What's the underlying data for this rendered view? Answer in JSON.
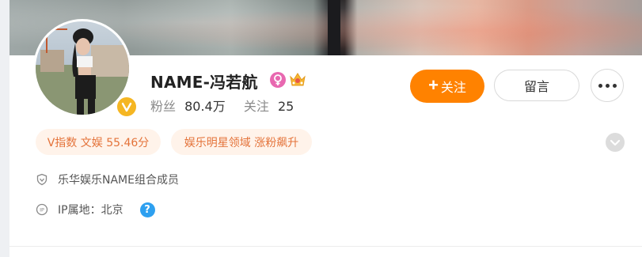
{
  "profile": {
    "name": "NAME-冯若航",
    "followers_label": "粉丝",
    "followers_value": "80.4万",
    "following_label": "关注",
    "following_value": "25"
  },
  "actions": {
    "follow_plus": "+",
    "follow_label": "关注",
    "message_label": "留言"
  },
  "tags": [
    {
      "text": "V指数 文娱 55.46分"
    },
    {
      "text": "娱乐明星领域 涨粉飙升"
    }
  ],
  "info": {
    "bio": "乐华娱乐NAME组合成员",
    "location": "IP属地：北京",
    "help_glyph": "?"
  },
  "icons": {
    "verified": "verified-badge-icon",
    "gender": "female-icon",
    "vip": "vip-crown-icon",
    "more": "more-dots-icon",
    "expand": "chevron-down-icon",
    "bio": "shield-icon",
    "ip": "ip-location-icon",
    "help": "help-icon"
  },
  "colors": {
    "accent": "#ff8200",
    "tag_bg": "#fff3ea",
    "tag_text": "#e4733a",
    "verified": "#f5b623",
    "female": "#e868b0",
    "help": "#2ea0f0"
  }
}
